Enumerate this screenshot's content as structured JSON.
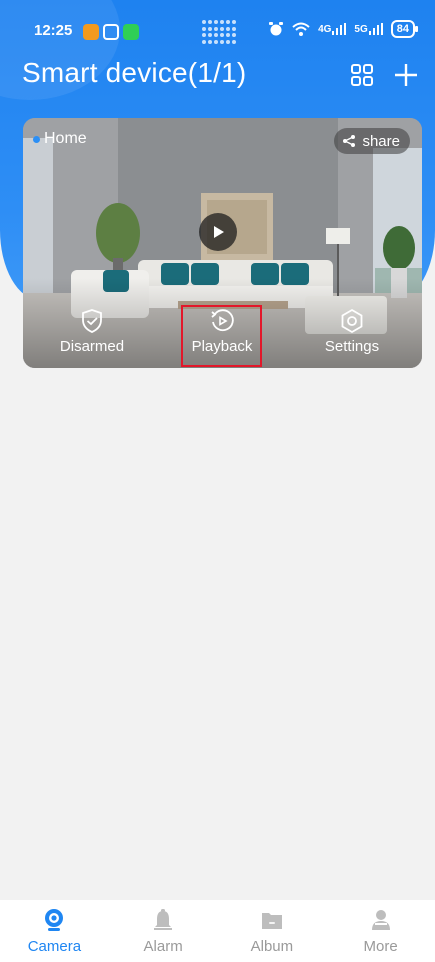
{
  "status_bar": {
    "time": "12:25",
    "signal_1": "4G",
    "signal_2": "5G",
    "battery": "84"
  },
  "header": {
    "title": "Smart device(1/1)"
  },
  "device": {
    "name": "Home",
    "share_label": "share",
    "actions": {
      "disarmed": "Disarmed",
      "playback": "Playback",
      "settings": "Settings"
    }
  },
  "bottom_nav": {
    "items": [
      {
        "label": "Camera",
        "icon": "camera-icon",
        "active": true
      },
      {
        "label": "Alarm",
        "icon": "bell-icon",
        "active": false
      },
      {
        "label": "Album",
        "icon": "folder-icon",
        "active": false
      },
      {
        "label": "More",
        "icon": "user-icon",
        "active": false
      }
    ]
  },
  "colors": {
    "primary": "#1f86f2",
    "highlight": "#e3172a",
    "inactive": "#9a9a9a"
  }
}
